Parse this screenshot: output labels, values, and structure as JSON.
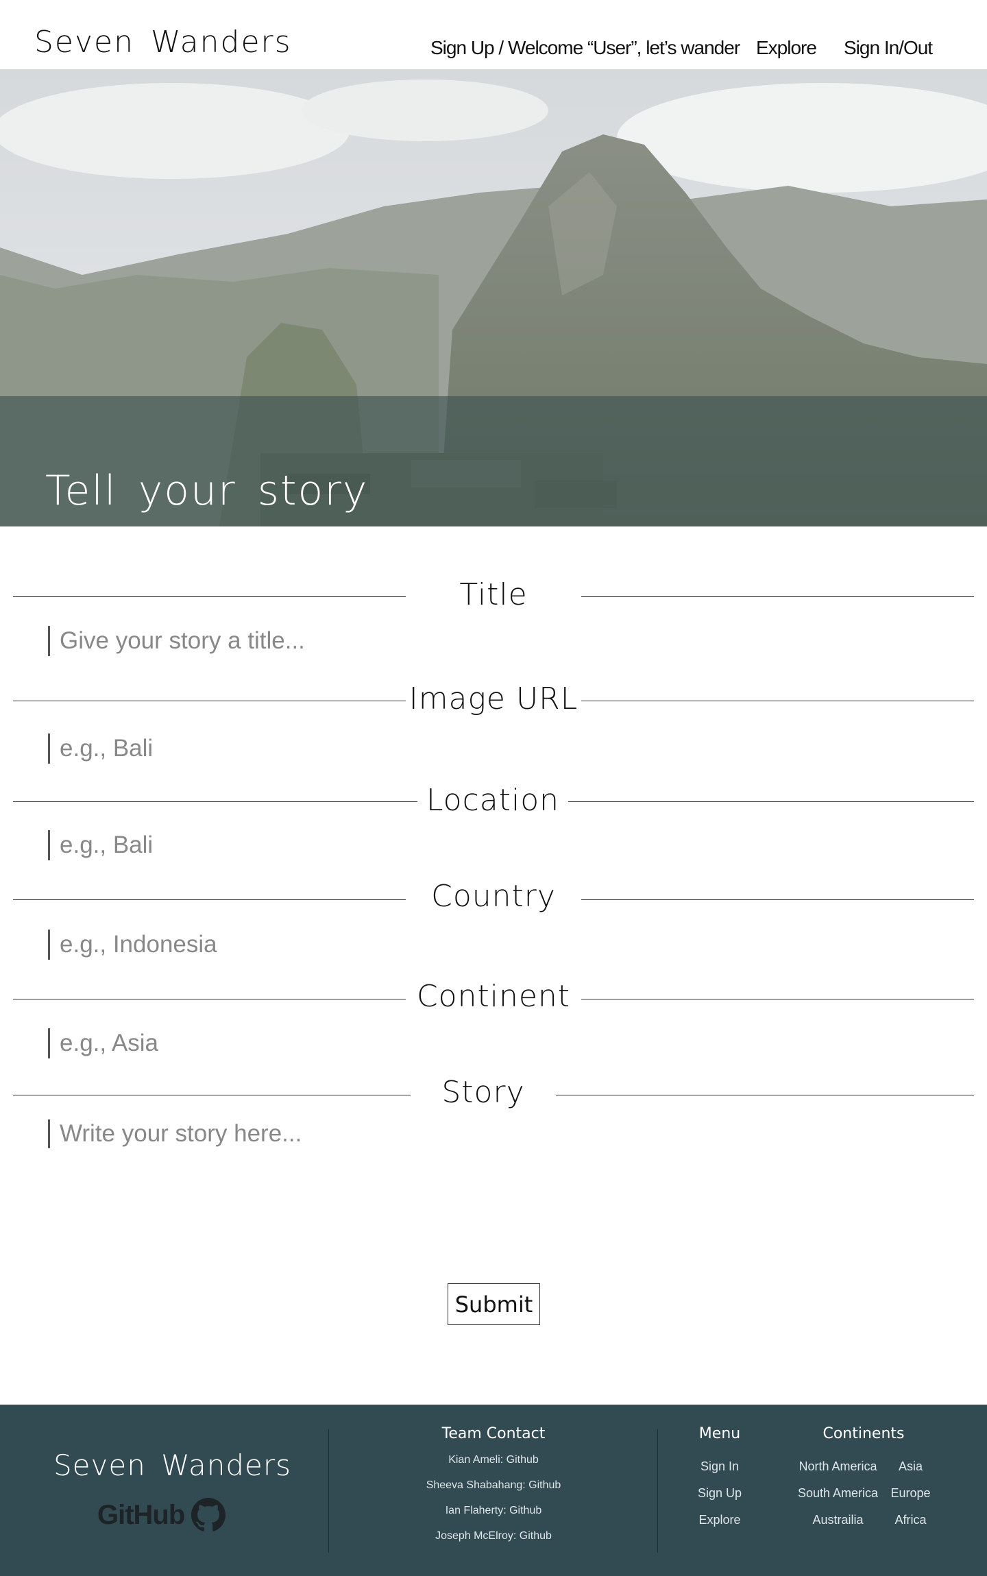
{
  "header": {
    "brand": "Seven Wanders",
    "nav": {
      "signup": "Sign Up / Welcome “User”, let’s wander",
      "explore": "Explore",
      "signin": "Sign In/Out"
    }
  },
  "hero": {
    "title": "Tell your story"
  },
  "form": {
    "title": {
      "label": "Title",
      "placeholder": "Give your story a title..."
    },
    "image_url": {
      "label": "Image URL",
      "placeholder": "e.g., Bali"
    },
    "location": {
      "label": "Location",
      "placeholder": "e.g., Bali"
    },
    "country": {
      "label": "Country",
      "placeholder": "e.g., Indonesia"
    },
    "continent": {
      "label": "Continent",
      "placeholder": "e.g., Asia"
    },
    "story": {
      "label": "Story",
      "placeholder": "Write your story here..."
    },
    "submit_label": "Submit"
  },
  "footer": {
    "brand": "Seven Wanders",
    "github_label": "GitHub",
    "team_contact": {
      "heading": "Team Contact",
      "members": [
        "Kian Ameli: Github",
        "Sheeva Shabahang: Github",
        "Ian Flaherty: Github",
        "Joseph McElroy: Github"
      ]
    },
    "menu": {
      "heading": "Menu",
      "items": [
        "Sign In",
        "Sign Up",
        "Explore"
      ]
    },
    "continents": {
      "heading": "Continents",
      "items": [
        "North America",
        "Asia",
        "South America",
        "Europe",
        "Austrailia",
        "Africa"
      ]
    }
  }
}
